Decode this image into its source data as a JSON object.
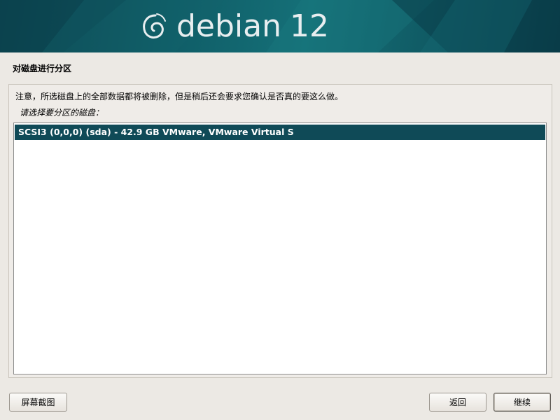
{
  "banner": {
    "brand": "debian",
    "version": "12",
    "logo_icon": "debian-swirl-icon"
  },
  "page": {
    "title": "对磁盘进行分区",
    "note": "注意，所选磁盘上的全部数据都将被删除，但是稍后还会要求您确认是否真的要这么做。",
    "prompt": "请选择要分区的磁盘："
  },
  "disks": [
    {
      "label": "SCSI3 (0,0,0) (sda) - 42.9 GB VMware, VMware Virtual S",
      "selected": true
    }
  ],
  "buttons": {
    "screenshot": "屏幕截图",
    "back": "返回",
    "continue": "继续"
  },
  "colors": {
    "banner": "#0f5c66",
    "selection": "#0f4a57",
    "background": "#ece9e4"
  }
}
